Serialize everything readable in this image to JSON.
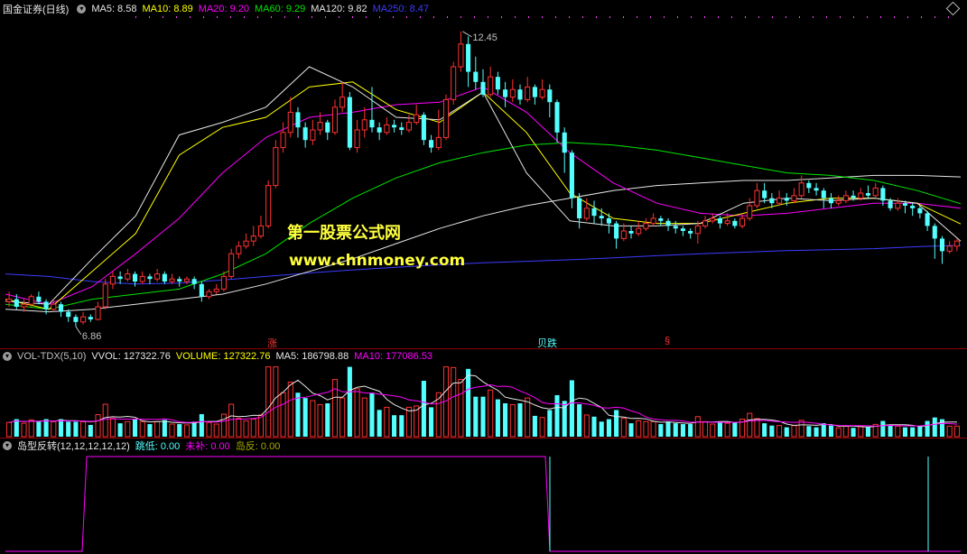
{
  "chart_data": {
    "type": "candlestick",
    "title": "国金证券(日线)",
    "price_range": [
      6.5,
      13.0
    ],
    "annotations": {
      "high_label": "12.45",
      "low_label": "6.86",
      "markers": [
        "涨",
        "贝跌",
        "§"
      ]
    },
    "candles": [
      [
        7.35,
        7.4,
        7.55,
        7.25
      ],
      [
        7.4,
        7.25,
        7.5,
        7.2
      ],
      [
        7.25,
        7.3,
        7.4,
        7.15
      ],
      [
        7.3,
        7.45,
        7.5,
        7.25
      ],
      [
        7.45,
        7.35,
        7.55,
        7.3
      ],
      [
        7.35,
        7.2,
        7.4,
        7.1
      ],
      [
        7.2,
        7.3,
        7.4,
        7.15
      ],
      [
        7.3,
        7.15,
        7.35,
        7.05
      ],
      [
        7.15,
        7.05,
        7.2,
        6.95
      ],
      [
        7.05,
        6.95,
        7.1,
        6.86
      ],
      [
        6.95,
        7.05,
        7.15,
        6.9
      ],
      [
        7.05,
        7.0,
        7.1,
        6.95
      ],
      [
        7.0,
        7.25,
        7.35,
        6.98
      ],
      [
        7.25,
        7.7,
        7.8,
        7.2
      ],
      [
        7.7,
        7.85,
        7.95,
        7.6
      ],
      [
        7.85,
        7.8,
        7.95,
        7.7
      ],
      [
        7.8,
        7.9,
        8.0,
        7.75
      ],
      [
        7.9,
        7.75,
        7.95,
        7.65
      ],
      [
        7.75,
        7.85,
        7.95,
        7.7
      ],
      [
        7.85,
        7.8,
        7.9,
        7.7
      ],
      [
        7.8,
        7.9,
        8.0,
        7.75
      ],
      [
        7.9,
        7.75,
        7.95,
        7.7
      ],
      [
        7.75,
        7.8,
        7.9,
        7.7
      ],
      [
        7.8,
        7.75,
        7.85,
        7.65
      ],
      [
        7.75,
        7.8,
        7.85,
        7.7
      ],
      [
        7.8,
        7.7,
        7.85,
        7.6
      ],
      [
        7.7,
        7.45,
        7.75,
        7.35
      ],
      [
        7.45,
        7.55,
        7.6,
        7.4
      ],
      [
        7.55,
        7.6,
        7.7,
        7.5
      ],
      [
        7.6,
        7.85,
        7.95,
        7.55
      ],
      [
        7.85,
        8.3,
        8.4,
        7.8
      ],
      [
        8.3,
        8.45,
        8.55,
        8.2
      ],
      [
        8.45,
        8.55,
        8.7,
        8.4
      ],
      [
        8.55,
        8.65,
        8.85,
        8.45
      ],
      [
        8.65,
        8.85,
        9.05,
        8.6
      ],
      [
        8.85,
        9.65,
        9.75,
        8.8
      ],
      [
        9.65,
        10.4,
        10.55,
        9.6
      ],
      [
        10.4,
        10.7,
        10.9,
        10.3
      ],
      [
        10.7,
        11.1,
        11.4,
        10.6
      ],
      [
        11.1,
        10.8,
        11.2,
        10.6
      ],
      [
        10.8,
        10.55,
        10.9,
        10.4
      ],
      [
        10.55,
        10.75,
        10.95,
        10.45
      ],
      [
        10.75,
        10.9,
        11.1,
        10.65
      ],
      [
        10.9,
        10.7,
        10.95,
        10.55
      ],
      [
        10.7,
        11.2,
        11.35,
        10.65
      ],
      [
        11.2,
        11.4,
        11.7,
        11.1
      ],
      [
        11.4,
        10.4,
        11.5,
        10.35
      ],
      [
        10.4,
        10.75,
        10.95,
        10.3
      ],
      [
        10.75,
        10.95,
        11.2,
        10.6
      ],
      [
        10.95,
        10.8,
        11.6,
        10.7
      ],
      [
        10.8,
        10.7,
        10.9,
        10.55
      ],
      [
        10.7,
        10.85,
        11.0,
        10.65
      ],
      [
        10.85,
        10.8,
        10.95,
        10.7
      ],
      [
        10.8,
        10.75,
        10.9,
        10.65
      ],
      [
        10.75,
        10.9,
        11.05,
        10.7
      ],
      [
        10.9,
        11.05,
        11.25,
        10.85
      ],
      [
        11.05,
        10.55,
        11.1,
        10.45
      ],
      [
        10.55,
        10.4,
        10.65,
        10.3
      ],
      [
        10.4,
        10.6,
        11.15,
        10.35
      ],
      [
        10.6,
        11.35,
        11.45,
        10.55
      ],
      [
        11.35,
        12.0,
        12.1,
        11.25
      ],
      [
        12.0,
        12.45,
        12.7,
        11.9
      ],
      [
        12.45,
        11.9,
        12.6,
        11.6
      ],
      [
        11.9,
        11.7,
        12.2,
        11.55
      ],
      [
        11.7,
        11.45,
        11.95,
        11.4
      ],
      [
        11.45,
        11.8,
        12.0,
        11.4
      ],
      [
        11.8,
        11.55,
        11.9,
        11.45
      ],
      [
        11.55,
        11.4,
        11.7,
        11.2
      ],
      [
        11.4,
        11.55,
        11.75,
        11.3
      ],
      [
        11.55,
        11.35,
        11.65,
        11.25
      ],
      [
        11.35,
        11.6,
        11.8,
        11.3
      ],
      [
        11.6,
        11.4,
        11.65,
        11.25
      ],
      [
        11.4,
        11.55,
        11.75,
        11.35
      ],
      [
        11.55,
        11.3,
        11.65,
        11.0
      ],
      [
        11.3,
        10.7,
        11.35,
        10.5
      ],
      [
        10.7,
        10.3,
        10.8,
        9.9
      ],
      [
        10.3,
        9.4,
        10.35,
        9.2
      ],
      [
        9.4,
        9.0,
        9.5,
        8.8
      ],
      [
        9.0,
        9.2,
        9.4,
        8.95
      ],
      [
        9.2,
        9.05,
        9.35,
        8.9
      ],
      [
        9.05,
        9.0,
        9.2,
        8.85
      ],
      [
        9.0,
        8.9,
        9.1,
        8.7
      ],
      [
        8.9,
        8.6,
        8.95,
        8.4
      ],
      [
        8.6,
        8.75,
        8.9,
        8.55
      ],
      [
        8.75,
        8.7,
        8.85,
        8.6
      ],
      [
        8.7,
        8.8,
        8.95,
        8.65
      ],
      [
        8.8,
        8.9,
        9.0,
        8.75
      ],
      [
        8.9,
        9.0,
        9.1,
        8.85
      ],
      [
        9.0,
        8.95,
        9.05,
        8.85
      ],
      [
        8.95,
        8.85,
        9.0,
        8.75
      ],
      [
        8.85,
        8.8,
        8.95,
        8.7
      ],
      [
        8.8,
        8.75,
        8.85,
        8.65
      ],
      [
        8.75,
        8.7,
        8.8,
        8.6
      ],
      [
        8.7,
        8.85,
        8.95,
        8.5
      ],
      [
        8.85,
        8.95,
        9.05,
        8.8
      ],
      [
        8.95,
        9.0,
        9.1,
        8.9
      ],
      [
        9.0,
        8.9,
        9.05,
        8.8
      ],
      [
        8.9,
        8.95,
        9.1,
        8.85
      ],
      [
        8.95,
        8.85,
        9.0,
        8.8
      ],
      [
        8.85,
        9.0,
        9.1,
        8.8
      ],
      [
        9.0,
        9.25,
        9.4,
        8.95
      ],
      [
        9.25,
        9.55,
        9.7,
        9.2
      ],
      [
        9.55,
        9.4,
        9.7,
        9.3
      ],
      [
        9.4,
        9.3,
        9.5,
        9.2
      ],
      [
        9.3,
        9.4,
        9.55,
        9.25
      ],
      [
        9.4,
        9.35,
        9.5,
        9.25
      ],
      [
        9.35,
        9.45,
        9.6,
        9.3
      ],
      [
        9.45,
        9.7,
        9.85,
        9.4
      ],
      [
        9.7,
        9.6,
        9.75,
        9.5
      ],
      [
        9.6,
        9.55,
        9.7,
        9.45
      ],
      [
        9.55,
        9.4,
        9.6,
        9.2
      ],
      [
        9.4,
        9.3,
        9.5,
        9.2
      ],
      [
        9.3,
        9.35,
        9.45,
        9.25
      ],
      [
        9.35,
        9.45,
        9.55,
        9.3
      ],
      [
        9.45,
        9.4,
        9.55,
        9.35
      ],
      [
        9.4,
        9.5,
        9.6,
        9.35
      ],
      [
        9.5,
        9.45,
        9.65,
        9.4
      ],
      [
        9.45,
        9.6,
        9.7,
        9.4
      ],
      [
        9.6,
        9.35,
        9.65,
        9.25
      ],
      [
        9.35,
        9.2,
        9.4,
        9.15
      ],
      [
        9.2,
        9.3,
        9.4,
        9.15
      ],
      [
        9.3,
        9.25,
        9.35,
        9.1
      ],
      [
        9.25,
        9.2,
        9.3,
        9.05
      ],
      [
        9.2,
        9.1,
        9.25,
        9.0
      ],
      [
        9.1,
        8.85,
        9.15,
        8.75
      ],
      [
        8.85,
        8.6,
        8.9,
        8.2
      ],
      [
        8.6,
        8.35,
        8.65,
        8.1
      ],
      [
        8.35,
        8.45,
        8.55,
        8.3
      ],
      [
        8.45,
        8.55,
        8.6,
        8.35
      ]
    ],
    "ma_values": {
      "MA5": 8.58,
      "MA10": 8.89,
      "MA20": 9.2,
      "MA60": 9.29,
      "MA120": 9.82,
      "MA250": 8.47
    },
    "ma_lines": {
      "MA5": [
        7.36,
        7.3,
        8.2,
        9.05,
        10.65,
        10.9,
        11.2,
        12.0,
        11.6,
        11.0,
        10.95,
        11.5,
        9.9,
        8.95,
        8.85,
        8.85,
        8.9,
        9.3,
        9.4,
        9.35,
        9.4,
        9.3,
        8.55
      ],
      "MA10": [
        7.4,
        7.2,
        7.95,
        8.7,
        10.25,
        10.8,
        11.0,
        11.6,
        11.7,
        11.15,
        10.9,
        11.5,
        10.7,
        9.5,
        9.0,
        8.9,
        8.9,
        9.1,
        9.3,
        9.4,
        9.4,
        9.3,
        8.89
      ],
      "MA20": [
        7.5,
        7.3,
        7.65,
        8.3,
        9.0,
        9.9,
        10.6,
        11.0,
        11.1,
        11.25,
        11.3,
        11.6,
        11.1,
        10.3,
        9.7,
        9.3,
        9.1,
        9.05,
        9.1,
        9.2,
        9.3,
        9.3,
        9.2
      ],
      "MA60": [
        7.3,
        7.2,
        7.4,
        7.5,
        7.6,
        7.9,
        8.3,
        8.9,
        9.4,
        9.8,
        10.1,
        10.3,
        10.45,
        10.5,
        10.45,
        10.35,
        10.2,
        10.05,
        9.9,
        9.85,
        9.75,
        9.55,
        9.29
      ],
      "MA120": [
        7.2,
        7.15,
        7.2,
        7.3,
        7.4,
        7.5,
        7.7,
        7.95,
        8.2,
        8.5,
        8.8,
        9.05,
        9.25,
        9.4,
        9.55,
        9.65,
        9.7,
        9.75,
        9.75,
        9.8,
        9.85,
        9.85,
        9.82
      ],
      "MA250": [
        7.9,
        7.85,
        7.75,
        7.7,
        7.72,
        7.78,
        7.85,
        7.92,
        7.98,
        8.03,
        8.08,
        8.12,
        8.15,
        8.18,
        8.22,
        8.26,
        8.3,
        8.33,
        8.36,
        8.38,
        8.4,
        8.44,
        8.47
      ]
    },
    "volume": {
      "indicator": "VOL-TDX(5,10)",
      "VVOL": 127322.76,
      "VOLUME": 127322.76,
      "MA5": 186798.88,
      "MA10": 177086.53,
      "range": [
        0,
        560000
      ]
    },
    "island": {
      "title": "岛型反转(12,12,12,12,12)",
      "jump_low": 0.0,
      "not_filled": 0.0,
      "island_reversal": 0.0
    }
  },
  "labels": {
    "stock": "国金证券(日线)",
    "ma5": "MA5: 8.58",
    "ma10": "MA10: 8.89",
    "ma20": "MA20: 9.20",
    "ma60": "MA60: 9.29",
    "ma120": "MA120: 9.82",
    "ma250": "MA250: 8.47",
    "vol_title": "VOL-TDX(5,10)",
    "vvol": "VVOL: 127322.76",
    "volume": "VOLUME: 127322.76",
    "vma5": "MA5: 186798.88",
    "vma10": "MA10: 177086.53",
    "island_title": "岛型反转(12,12,12,12,12)",
    "jump": "跳低: 0.00",
    "notfill": "未补: 0.00",
    "island": "岛反: 0.00",
    "hi": "12.45",
    "lo": "6.86",
    "m1": "涨",
    "m2": "贝跌",
    "m3": "§",
    "watermark1": "第一股票公式网",
    "watermark2": "www.chnmoney.com"
  },
  "colors": {
    "up": "#ff3232",
    "down": "#54ffff",
    "ma5": "#e6e6e6",
    "ma10": "#ffff00",
    "ma20": "#ff00ff",
    "ma60": "#00e600",
    "ma120": "#e6e6e6",
    "ma250": "#3c3cff"
  }
}
